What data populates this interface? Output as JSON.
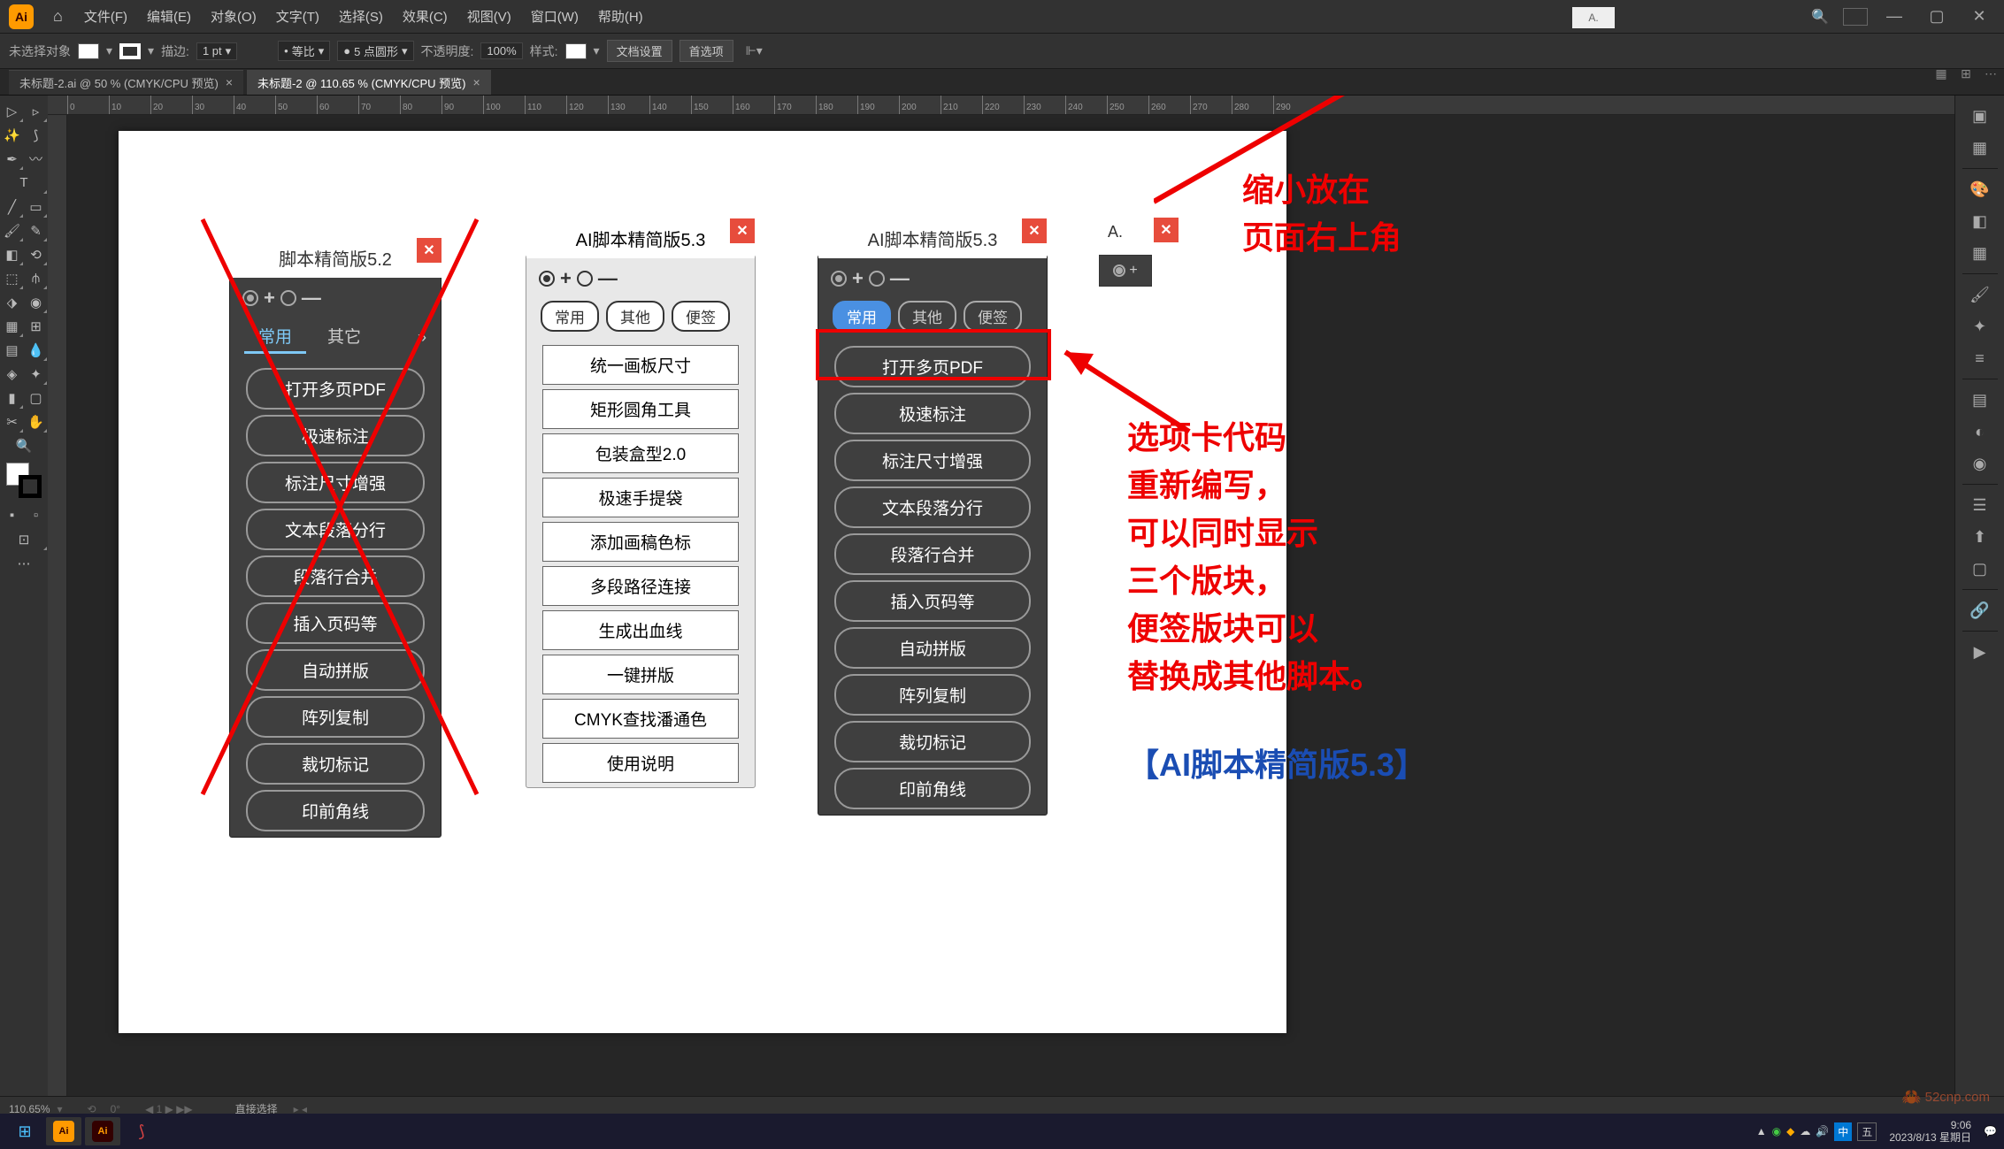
{
  "menubar": {
    "logo": "Ai",
    "items": [
      "文件(F)",
      "编辑(E)",
      "对象(O)",
      "文字(T)",
      "选择(S)",
      "效果(C)",
      "视图(V)",
      "窗口(W)",
      "帮助(H)"
    ]
  },
  "controlbar": {
    "no_selection": "未选择对象",
    "stroke_label": "描边:",
    "stroke_value": "1 pt",
    "uniform": "等比",
    "points": "5 点圆形",
    "opacity_label": "不透明度:",
    "opacity_value": "100%",
    "style_label": "样式:",
    "doc_setup": "文档设置",
    "prefs": "首选项"
  },
  "tabs": [
    {
      "label": "未标题-2.ai @ 50 % (CMYK/CPU 预览)",
      "active": false
    },
    {
      "label": "未标题-2 @ 110.65 % (CMYK/CPU 预览)",
      "active": true
    }
  ],
  "ruler_ticks": [
    "0",
    "10",
    "20",
    "30",
    "40",
    "50",
    "60",
    "70",
    "80",
    "90",
    "100",
    "110",
    "120",
    "130",
    "140",
    "150",
    "160",
    "170",
    "180",
    "190",
    "200",
    "210",
    "220",
    "230",
    "240",
    "250",
    "260",
    "270",
    "280",
    "290"
  ],
  "panel52": {
    "title": "脚本精简版5.2",
    "tabs": [
      "常用",
      "其它"
    ],
    "buttons": [
      "打开多页PDF",
      "极速标注",
      "标注尺寸增强",
      "文本段落分行",
      "段落行合并",
      "插入页码等",
      "自动拼版",
      "阵列复制",
      "裁切标记",
      "印前角线"
    ]
  },
  "panel53light": {
    "title": "AI脚本精简版5.3",
    "tabs": [
      "常用",
      "其他",
      "便签"
    ],
    "buttons": [
      "统一画板尺寸",
      "矩形圆角工具",
      "包装盒型2.0",
      "极速手提袋",
      "添加画稿色标",
      "多段路径连接",
      "生成出血线",
      "一键拼版",
      "CMYK查找潘通色",
      "使用说明"
    ]
  },
  "panel53dark": {
    "title": "AI脚本精简版5.3",
    "tabs": [
      "常用",
      "其他",
      "便签"
    ],
    "buttons": [
      "打开多页PDF",
      "极速标注",
      "标注尺寸增强",
      "文本段落分行",
      "段落行合并",
      "插入页码等",
      "自动拼版",
      "阵列复制",
      "裁切标记",
      "印前角线"
    ]
  },
  "mini_panel_label": "A.",
  "annotations": {
    "top1": "缩小放在",
    "top2": "页面右上角",
    "mid1": "选项卡代码",
    "mid2": "重新编写，",
    "mid3": "可以同时显示",
    "mid4": "三个版块，",
    "mid5": "便签版块可以",
    "mid6": "替换成其他脚本。",
    "bottom": "【AI脚本精简版5.3】"
  },
  "status": {
    "zoom": "110.65%",
    "tool": "直接选择"
  },
  "taskbar": {
    "time": "9:06",
    "date": "2023/8/13 星期日"
  },
  "watermark": "52cnp.com",
  "top_widget": "A."
}
